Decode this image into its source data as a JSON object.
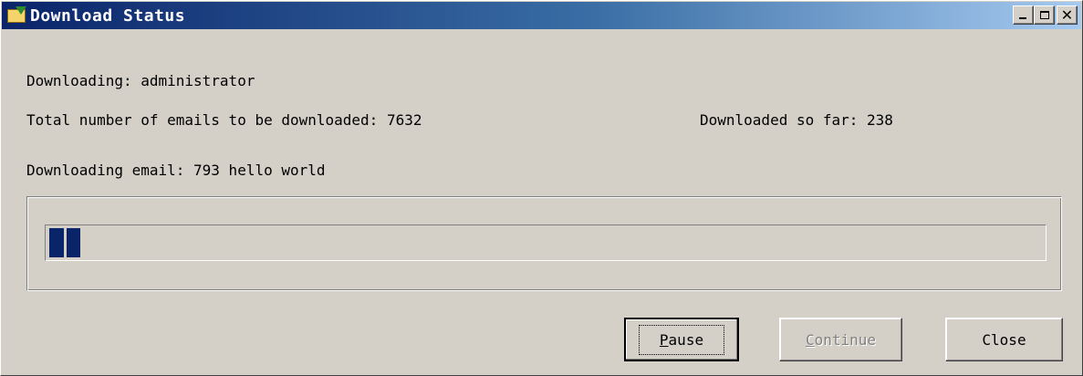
{
  "window": {
    "title": "Download Status",
    "icon": "mail-download-icon",
    "controls": {
      "minimize": "minimize-icon",
      "maximize": "maximize-icon",
      "close": "close-icon"
    }
  },
  "status": {
    "downloading_label": "Downloading: administrator",
    "total_label": "Total number of emails to be downloaded: 7632",
    "so_far_label": "Downloaded so far: 238",
    "current_email_label": "Downloading email: 793 hello world"
  },
  "progress": {
    "fraction": 0.031,
    "accent": "#0a246a"
  },
  "buttons": {
    "pause": "Pause",
    "continue": "Continue",
    "close": "Close"
  },
  "colors": {
    "face": "#d4d0c8",
    "title_start": "#0a246a",
    "title_end": "#a6caf0"
  }
}
